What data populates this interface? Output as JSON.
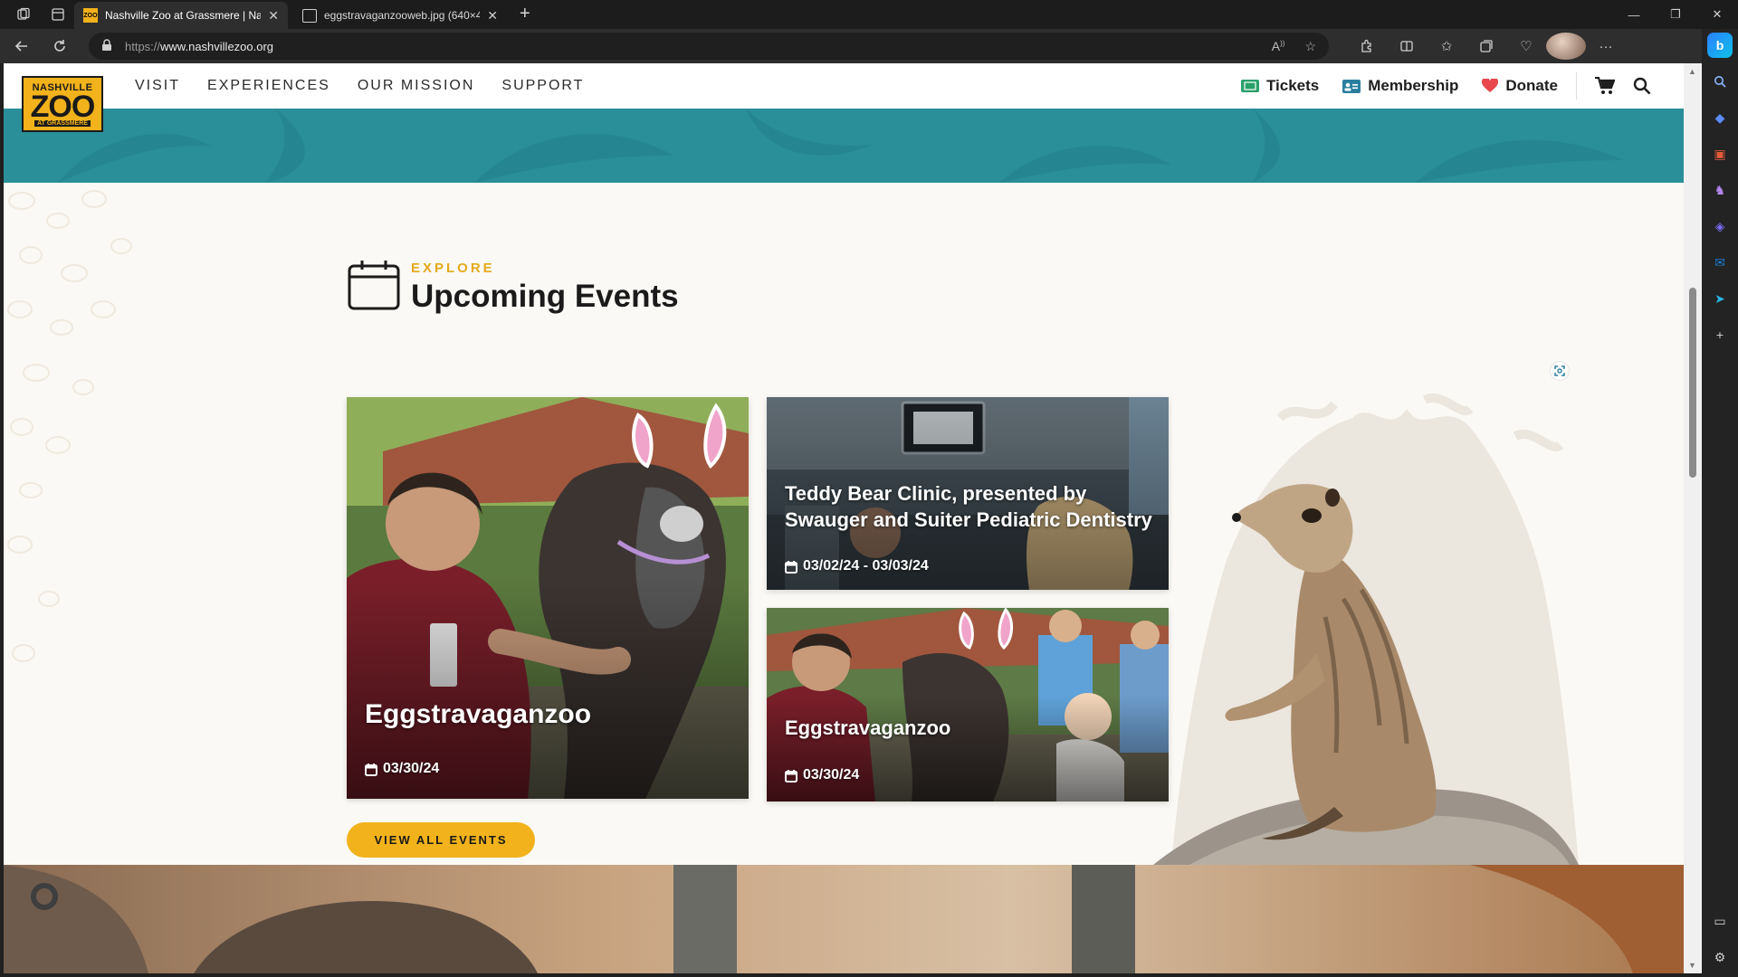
{
  "browser": {
    "tabs": [
      {
        "title": "Nashville Zoo at Grassmere | Nas",
        "active": true,
        "favicon": "zoo-favicon"
      },
      {
        "title": "eggstravaganzooweb.jpg (640×4",
        "active": false,
        "favicon": "document-icon"
      }
    ],
    "address": {
      "scheme": "https://",
      "host": "www.nashvillezoo.org"
    }
  },
  "site": {
    "logo": {
      "line1": "NASHVILLE",
      "line2": "ZOO",
      "line3": "AT GRASSMERE"
    },
    "nav": [
      "VISIT",
      "EXPERIENCES",
      "OUR MISSION",
      "SUPPORT"
    ],
    "utility": {
      "tickets": "Tickets",
      "membership": "Membership",
      "donate": "Donate"
    }
  },
  "events_section": {
    "eyebrow": "EXPLORE",
    "title": "Upcoming Events",
    "cards": [
      {
        "title": "Eggstravaganzoo",
        "date": "03/30/24"
      },
      {
        "title": "Teddy Bear Clinic, presented by Swauger and Suiter Pediatric Dentistry",
        "date": "03/02/24 - 03/03/24"
      },
      {
        "title": "Eggstravaganzoo",
        "date": "03/30/24"
      }
    ],
    "button": "VIEW ALL EVENTS"
  },
  "colors": {
    "accent": "#f2b21b",
    "teal": "#2a8f99",
    "title": "#1b1b1b",
    "eyebrow": "#e4a91c"
  }
}
